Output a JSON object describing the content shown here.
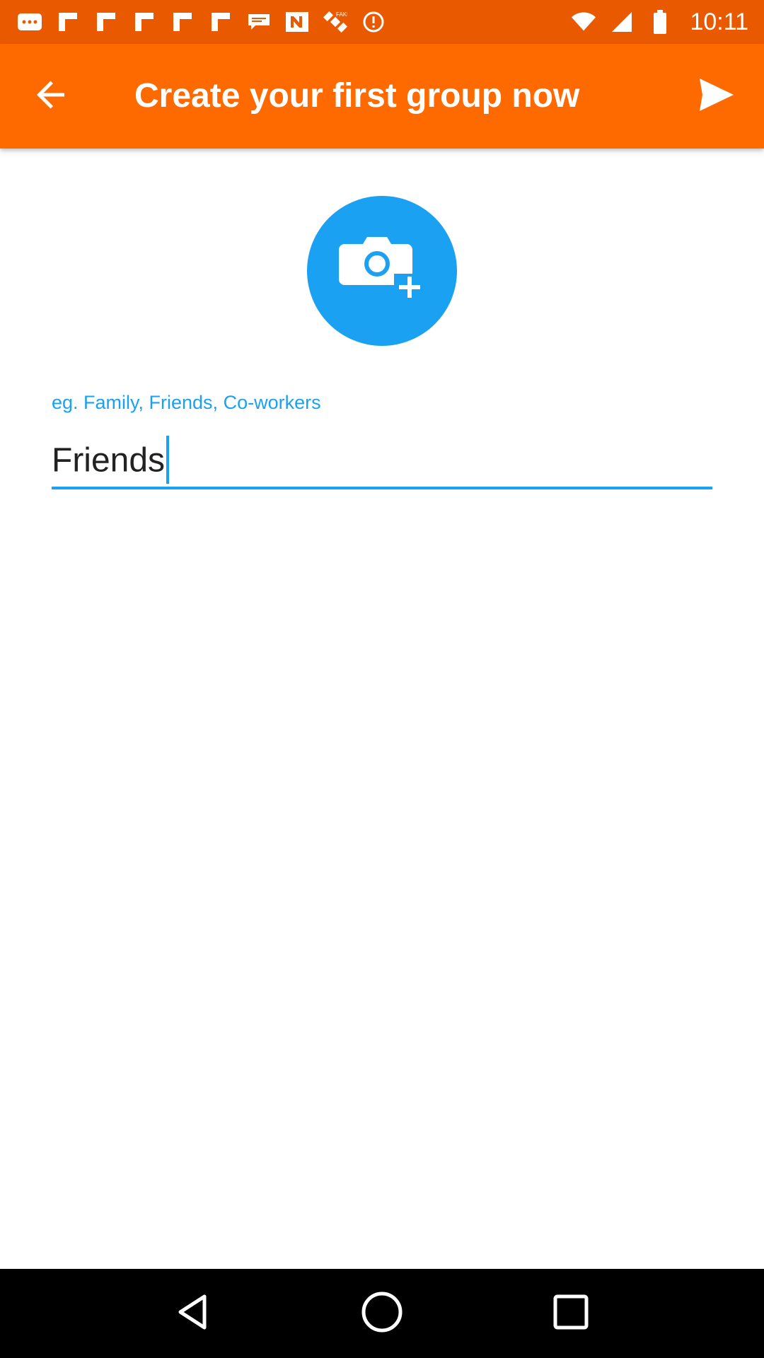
{
  "status_bar": {
    "time": "10:11",
    "left_icons": [
      "more-icon",
      "flipboard-icon",
      "flipboard-icon",
      "flipboard-icon",
      "flipboard-icon",
      "flipboard-icon",
      "message-icon",
      "news-icon",
      "satellite-icon",
      "alert-icon"
    ],
    "right_icons": [
      "wifi-icon",
      "signal-icon",
      "battery-icon"
    ]
  },
  "app_bar": {
    "title": "Create your first group now",
    "back_icon": "arrow-back-icon",
    "next_icon": "send-icon"
  },
  "photo_button": {
    "icon": "add-photo-icon"
  },
  "group_name_field": {
    "hint": "eg. Family, Friends, Co-workers",
    "value": "Friends"
  },
  "nav_bar": {
    "icons": [
      "back-triangle-icon",
      "home-circle-icon",
      "recents-square-icon"
    ]
  },
  "colors": {
    "status_bar": "#E95A00",
    "app_bar": "#FF6A00",
    "accent": "#1BA1F2",
    "background": "#FFFFFF",
    "nav_bar": "#000000"
  }
}
